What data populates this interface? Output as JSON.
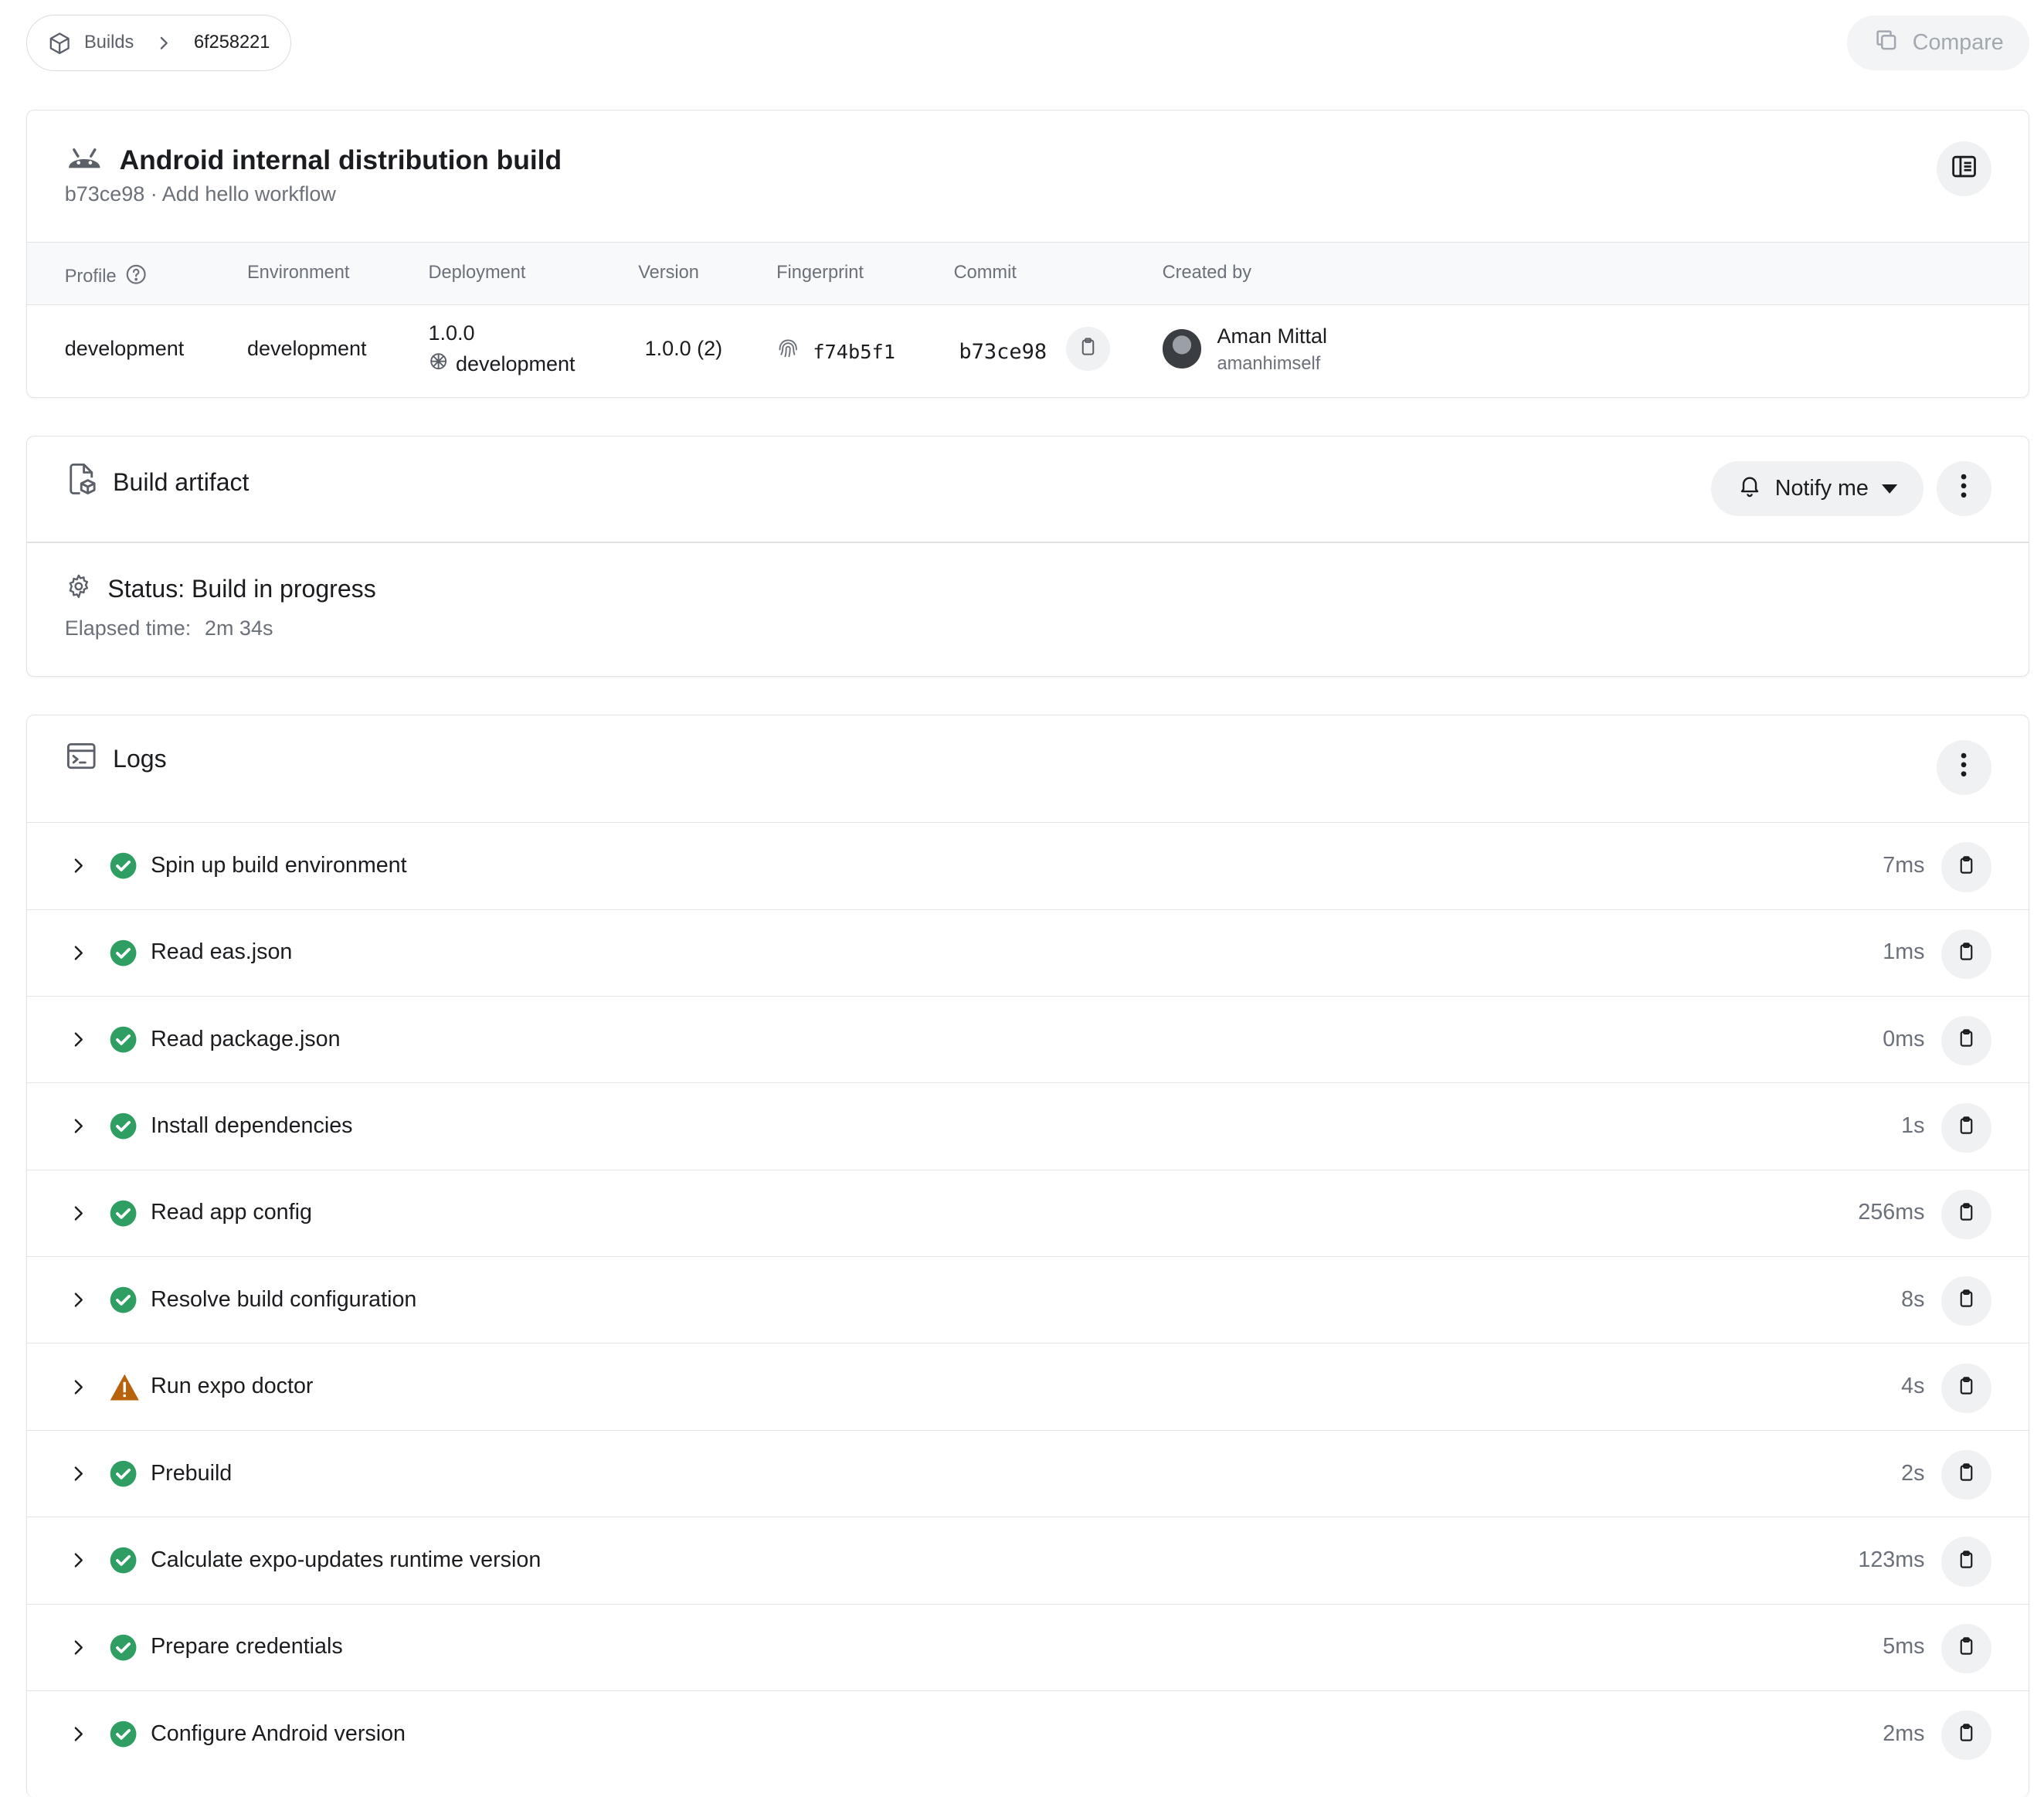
{
  "breadcrumb": {
    "builds_label": "Builds",
    "build_id": "6f258221"
  },
  "compare_label": "Compare",
  "build": {
    "title": "Android internal distribution build",
    "subtitle": "b73ce98 · Add hello workflow"
  },
  "meta": {
    "headers": {
      "profile": "Profile",
      "environment": "Environment",
      "deployment": "Deployment",
      "version": "Version",
      "fingerprint": "Fingerprint",
      "commit": "Commit",
      "created_by": "Created by"
    },
    "values": {
      "profile": "development",
      "environment": "development",
      "deployment_version": "1.0.0",
      "deployment_channel": "development",
      "version": "1.0.0 (2)",
      "fingerprint": "f74b5f1",
      "commit": "b73ce98",
      "creator_name": "Aman Mittal",
      "creator_username": "amanhimself"
    }
  },
  "artifact": {
    "title": "Build artifact",
    "notify_label": "Notify me",
    "status": "Status: Build in progress",
    "elapsed_label": "Elapsed time:",
    "elapsed_value": "2m 34s"
  },
  "logs": {
    "title": "Logs",
    "rows": [
      {
        "label": "Spin up build environment",
        "duration": "7ms",
        "status": "success"
      },
      {
        "label": "Read eas.json",
        "duration": "1ms",
        "status": "success"
      },
      {
        "label": "Read package.json",
        "duration": "0ms",
        "status": "success"
      },
      {
        "label": "Install dependencies",
        "duration": "1s",
        "status": "success"
      },
      {
        "label": "Read app config",
        "duration": "256ms",
        "status": "success"
      },
      {
        "label": "Resolve build configuration",
        "duration": "8s",
        "status": "success"
      },
      {
        "label": "Run expo doctor",
        "duration": "4s",
        "status": "warning"
      },
      {
        "label": "Prebuild",
        "duration": "2s",
        "status": "success"
      },
      {
        "label": "Calculate expo-updates runtime version",
        "duration": "123ms",
        "status": "success"
      },
      {
        "label": "Prepare credentials",
        "duration": "5ms",
        "status": "success"
      },
      {
        "label": "Configure Android version",
        "duration": "2ms",
        "status": "success"
      }
    ]
  },
  "colors": {
    "success": "#2f9e63",
    "warning": "#b8620b",
    "muted_text": "#6b7079",
    "border": "#e1e3e6"
  },
  "icons": {
    "breadcrumb": "cube-icon",
    "compare": "copy-icon",
    "platform": "android-icon",
    "sidebar": "sidebar-layout-icon",
    "profile_help": "help-circle-icon",
    "channel": "channel-icon",
    "fingerprint": "fingerprint-icon",
    "copy": "clipboard-icon",
    "artifact": "file-package-icon",
    "notify": "bell-icon",
    "more": "dots-vertical-icon",
    "status": "gear-icon",
    "logs": "terminal-icon",
    "expand": "chevron-right-icon",
    "success": "check-circle-icon",
    "warning": "warning-triangle-icon"
  }
}
